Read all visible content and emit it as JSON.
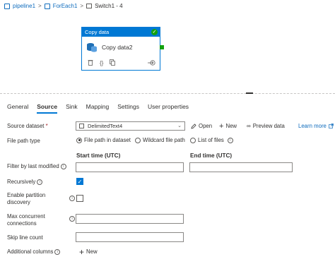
{
  "breadcrumb": {
    "items": [
      {
        "label": "pipeline1"
      },
      {
        "label": "ForEach1"
      },
      {
        "label": "Switch1 - 4"
      }
    ],
    "separator": ">"
  },
  "activity": {
    "header": "Copy data",
    "name": "Copy data2",
    "status_icon": "check-circle-icon",
    "footer_icons": [
      "delete-icon",
      "code-icon",
      "copy-icon",
      "go-arrow-icon"
    ]
  },
  "tabs": [
    {
      "label": "General",
      "active": false
    },
    {
      "label": "Source",
      "active": true
    },
    {
      "label": "Sink",
      "active": false
    },
    {
      "label": "Mapping",
      "active": false
    },
    {
      "label": "Settings",
      "active": false
    },
    {
      "label": "User properties",
      "active": false
    }
  ],
  "form": {
    "source_dataset": {
      "label": "Source dataset",
      "required_mark": "*",
      "value": "DelimitedText4",
      "open_label": "Open",
      "new_label": "New",
      "preview_label": "Preview data",
      "learn_more": "Learn more"
    },
    "file_path_type": {
      "label": "File path type",
      "options": [
        {
          "label": "File path in dataset",
          "selected": true
        },
        {
          "label": "Wildcard file path",
          "selected": false
        },
        {
          "label": "List of files",
          "selected": false
        }
      ]
    },
    "filter_last_modified": {
      "label": "Filter by last modified",
      "start_label": "Start time (UTC)",
      "end_label": "End time (UTC)",
      "start_value": "",
      "end_value": ""
    },
    "recursively": {
      "label": "Recursively",
      "checked": true
    },
    "enable_partition_discovery": {
      "label_line1": "Enable partition",
      "label_line2": "discovery",
      "checked": false
    },
    "max_concurrent": {
      "label_line1": "Max concurrent",
      "label_line2": "connections",
      "value": ""
    },
    "skip_line_count": {
      "label": "Skip line count",
      "value": ""
    },
    "additional_columns": {
      "label": "Additional columns",
      "new_label": "New"
    }
  },
  "colors": {
    "accent": "#0078d4",
    "success": "#13a10e",
    "link": "#0f6cbd"
  }
}
